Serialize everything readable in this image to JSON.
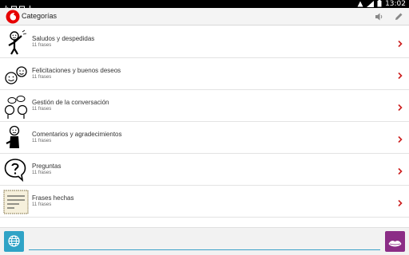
{
  "statusbar": {
    "time": "13:02"
  },
  "actionbar": {
    "title": "Categorías",
    "logo_color": "#e60000"
  },
  "categories": [
    {
      "name": "Saludos y despedidas",
      "count": "11 frases",
      "icon": "greeting-person-icon"
    },
    {
      "name": "Felicitaciones y buenos deseos",
      "count": "11 frases",
      "icon": "congratulations-faces-icon"
    },
    {
      "name": "Gestión de la conversación",
      "count": "11 frases",
      "icon": "conversation-faces-icon"
    },
    {
      "name": "Comentarios y agradecimientos",
      "count": "11 frases",
      "icon": "thanking-person-icon"
    },
    {
      "name": "Preguntas",
      "count": "11 frases",
      "icon": "question-bubble-icon"
    },
    {
      "name": "Frases hechas",
      "count": "11 frases",
      "icon": "sayings-card-icon"
    }
  ],
  "input": {
    "value": "",
    "placeholder": ""
  },
  "colors": {
    "accent_blue": "#2fa3c6",
    "accent_purple": "#8b2d86",
    "chevron": "#cc1f1f"
  }
}
